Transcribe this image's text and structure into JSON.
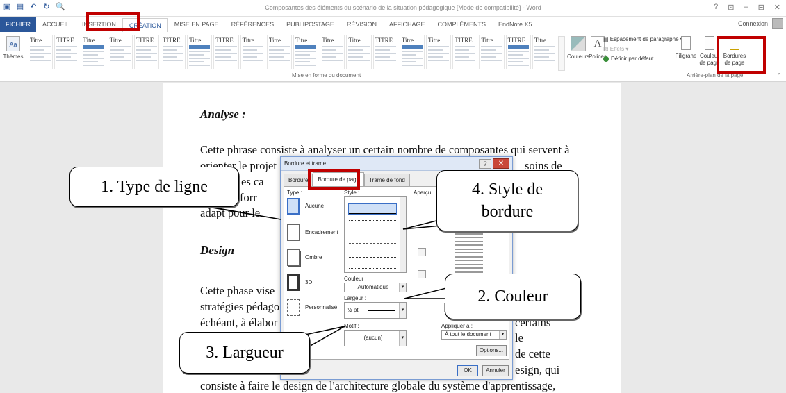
{
  "titlebar": {
    "title": "Composantes des éléments du scénario de la situation pédagogique [Mode de compatibilité] - Word",
    "controls": [
      "?",
      "⊡",
      "–",
      "⊟",
      "✕"
    ]
  },
  "tabs": [
    "FICHIER",
    "ACCUEIL",
    "INSERTION",
    "CRÉATION",
    "MISE EN PAGE",
    "RÉFÉRENCES",
    "PUBLIPOSTAGE",
    "RÉVISION",
    "AFFICHAGE",
    "COMPLÉMENTS",
    "EndNote X5"
  ],
  "signin": "Connexion",
  "ribbon": {
    "themes": "Thèmes",
    "style_titles": [
      "Titre",
      "TITRE",
      "Titre",
      "Titre",
      "TITRE",
      "TITRE",
      "Titre",
      "TITRE",
      "Titre",
      "Titre",
      "Titre",
      "Titre",
      "Titre",
      "TITRE",
      "Titre",
      "Titre",
      "TITRE",
      "Titre",
      "TITRE",
      "Titre"
    ],
    "colors": "Couleurs",
    "fonts": "Polices",
    "para_spacing": "Espacement de paragraphe",
    "effects": "Effets",
    "set_default": "Définir par défaut",
    "group_format": "Mise en forme du document",
    "watermark": "Filigrane",
    "page_color": "Couleur de page",
    "page_borders": "Bordures de page",
    "group_bg": "Arrière-plan de la page"
  },
  "document": {
    "h1": "Analyse :",
    "p1": [
      "Cette phrase consiste à analyser un certain nombre de composantes qui servent à",
      "orienter le projet",
      "soins de",
      "es ca",
      "forr",
      "adapt pour le"
    ],
    "h2": "Design",
    "p2": [
      "Cette phase vise",
      "stratégies pédago",
      "échéant, à élabor",
      "certains",
      "le",
      "de cette",
      "esign, qui",
      "consiste à faire le design de l'architecture globale du système d'apprentissage,"
    ]
  },
  "dialog": {
    "title": "Bordure et trame",
    "tabs": [
      "Bordure",
      "Bordure de page",
      "Trame de fond"
    ],
    "type_label": "Type :",
    "types": [
      "Aucune",
      "Encadrement",
      "Ombre",
      "3D",
      "Personnalisé"
    ],
    "style_label": "Style :",
    "preview_label": "Aperçu",
    "color_label": "Couleur :",
    "color_value": "Automatique",
    "width_label": "Largeur :",
    "width_value": "½ pt",
    "art_label": "Motif :",
    "art_value": "(aucun)",
    "apply_label": "Appliquer à :",
    "apply_value": "À tout le document",
    "options": "Options...",
    "ok": "OK",
    "cancel": "Annuler"
  },
  "callouts": {
    "c1": "1. Type de ligne",
    "c2": "2. Couleur",
    "c3": "3. Largueur",
    "c4a": "4. Style de",
    "c4b": "bordure"
  }
}
